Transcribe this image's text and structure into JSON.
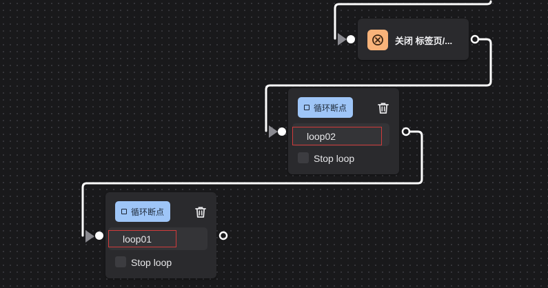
{
  "close_tab_node": {
    "title": "关闭 标签页/..."
  },
  "loop_break_node_2": {
    "badge": "循环断点",
    "loop_id": "loop02",
    "stop_loop_label": "Stop loop"
  },
  "loop_break_node_1": {
    "badge": "循环断点",
    "loop_id": "loop01",
    "stop_loop_label": "Stop loop"
  },
  "icons": {
    "close_tab": "close-circle-icon",
    "block": "square-icon",
    "delete": "trash-icon",
    "input_port": "arrow-port-icon",
    "output_port": "ring-port-icon"
  },
  "colors": {
    "canvas": "#19191b",
    "node": "#2a2a2d",
    "badge_blue": "#9ec5f7",
    "badge_orange": "#f8b37a",
    "input_highlight": "#d23b3b",
    "wire": "#ffffff"
  }
}
